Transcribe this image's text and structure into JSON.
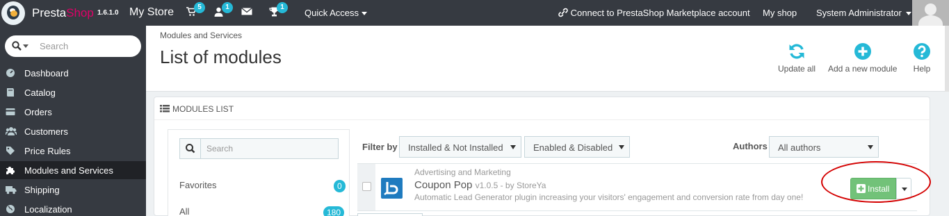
{
  "app": {
    "brand_presta": "Presta",
    "brand_shop": "Shop",
    "version": "1.6.1.0",
    "store_name": "My Store"
  },
  "topbar": {
    "orders_badge": "5",
    "customers_badge": "1",
    "trophy_badge": "1",
    "quick_access": "Quick Access",
    "connect": "Connect to PrestaShop Marketplace account",
    "my_shop": "My shop",
    "user": "System Administrator"
  },
  "sidebar": {
    "search_placeholder": "Search",
    "items": [
      {
        "label": "Dashboard",
        "icon": "dashboard-icon"
      },
      {
        "label": "Catalog",
        "icon": "book-icon"
      },
      {
        "label": "Orders",
        "icon": "credit-card-icon"
      },
      {
        "label": "Customers",
        "icon": "users-icon"
      },
      {
        "label": "Price Rules",
        "icon": "tags-icon"
      },
      {
        "label": "Modules and Services",
        "icon": "puzzle-icon",
        "active": true
      },
      {
        "label": "Shipping",
        "icon": "truck-icon"
      },
      {
        "label": "Localization",
        "icon": "globe-icon"
      }
    ]
  },
  "header": {
    "breadcrumb": "Modules and Services",
    "title": "List of modules",
    "update_all": "Update all",
    "add_module": "Add a new module",
    "help": "Help"
  },
  "panel": {
    "heading": "Modules list",
    "category_search_placeholder": "Search",
    "categories": [
      {
        "label": "Favorites",
        "count": "0"
      },
      {
        "label": "All",
        "count": "180"
      }
    ],
    "filter_by": "Filter by",
    "filter_install": "Installed & Not Installed",
    "filter_enabled": "Enabled & Disabled",
    "authors_label": "Authors",
    "authors_value": "All authors"
  },
  "module": {
    "category": "Advertising and Marketing",
    "name": "Coupon Pop",
    "version": "v1.0.5 - by StoreYa",
    "description": "Automatic Lead Generator plugin increasing your visitors' engagement and conversion rate from day one!",
    "install_label": "Install"
  },
  "colors": {
    "topbar": "#363a41",
    "accent": "#25b9d7",
    "install": "#72c279",
    "brand_pink": "#df0067",
    "annotation": "#d40000"
  }
}
